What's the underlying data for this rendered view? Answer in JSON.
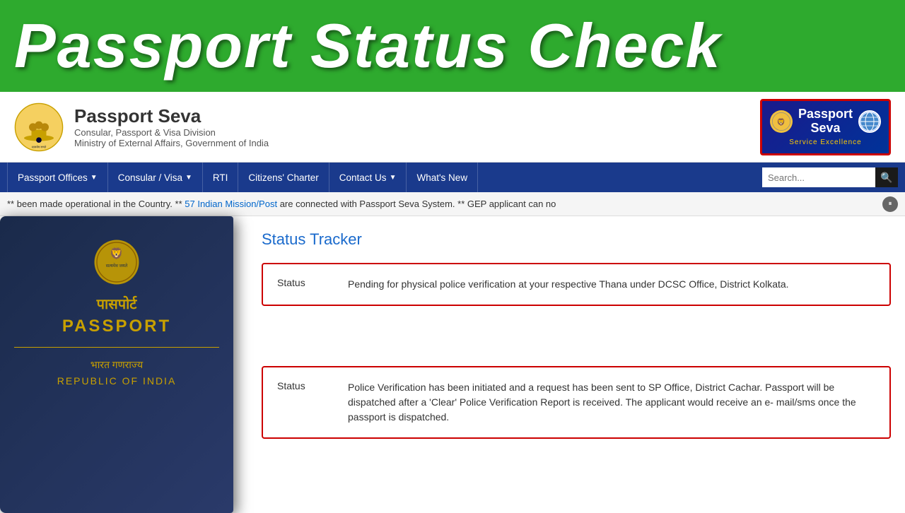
{
  "topBanner": {
    "title": "Passport Status Check"
  },
  "header": {
    "logoAlt": "Government of India Emblem",
    "siteName": "Passport Seva",
    "subtitle1": "Consular, Passport & Visa Division",
    "subtitle2": "Ministry of External Affairs, Government of India",
    "badgeText": "Passport\nSeva",
    "badgeSubtitle": "Service Excellence"
  },
  "navbar": {
    "items": [
      {
        "label": "Passport Offices",
        "hasDropdown": true
      },
      {
        "label": "Consular / Visa",
        "hasDropdown": true
      },
      {
        "label": "RTI",
        "hasDropdown": false
      },
      {
        "label": "Citizens' Charter",
        "hasDropdown": false
      },
      {
        "label": "Contact Us",
        "hasDropdown": true
      },
      {
        "label": "What's New",
        "hasDropdown": false
      }
    ],
    "searchPlaceholder": "Search..."
  },
  "ticker": {
    "text": " ** been made operational in the Country. ** ",
    "linkText": "57 Indian Mission/Post",
    "linkSuffix": " are connected with Passport Seva System. ** GEP applicant can no"
  },
  "statusTracker": {
    "title": "Status Tracker",
    "card1": {
      "label": "Status",
      "value": "Pending for physical police verification at your respective Thana under DCSC Office, District Kolkata."
    },
    "card2": {
      "label": "Status",
      "value": "Police Verification has been initiated and a request has been sent to SP Office, District Cachar. Passport will be dispatched after a 'Clear' Police Verification Report is received. The applicant would receive an e- mail/sms once the passport is dispatched."
    }
  },
  "passport": {
    "hindi": "पासपोर्ट",
    "english": "PASSPORT",
    "hindi2": "भारत गणराज्य",
    "english2": "REPUBLIC OF INDIA"
  }
}
